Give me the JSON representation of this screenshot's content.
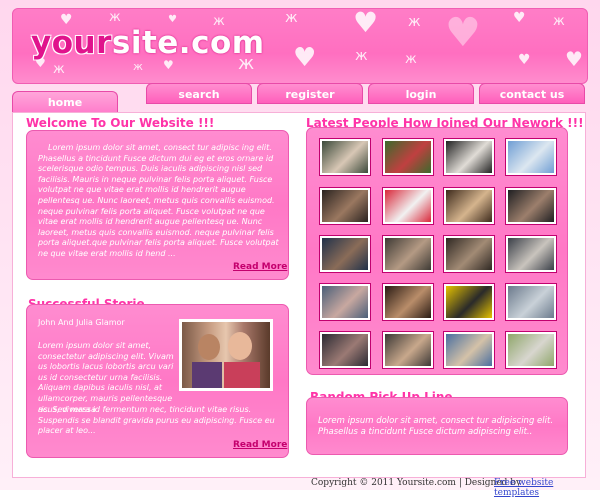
{
  "logo": {
    "part_a": "your",
    "part_b": "site.com"
  },
  "nav": {
    "home": "home",
    "search": "search",
    "register": "register",
    "login": "login",
    "contact": "contact us"
  },
  "welcome": {
    "title": "Welcome To Our Website !!!",
    "body": "Lorem ipsum dolor sit amet, consect tur adipisc ing elit. Phasellus a tincidunt Fusce dictum dui eg et eros ornare id scelerisque odio tempus. Duis iaculis adipiscing nisl sed facilisis. Mauris in neque pulvinar felis porta aliquet. Fusce volutpat ne que vitae erat mollis id hendrerit augue pellentesq ue. Nunc laoreet, metus quis convallis euismod. neque pulvinar felis porta aliquet. Fusce volutpat ne que vitae erat mollis id hendrerit augue pellentesq ue. Nunc laoreet, metus quis convallis euismod. neque pulvinar felis porta aliquet.que pulvinar felis porta aliquet. Fusce volutpat ne que vitae erat mollis id hend ...",
    "read_more": "Read More"
  },
  "story": {
    "title": "Successful Storie",
    "couple": "John And Julia Glamor",
    "body_narrow": "Lorem ipsum dolor sit amet, consectetur adipiscing elit. Vivam us lobortis lacus lobortis arcu vari us id consectetur urna facilisis. Aliquam dapibus iaculis nisl, at ullamcorper, mauris pellentesque ac. Sed massa",
    "body_wide": "risus, viverra id fermentum nec, tincidunt vitae risus. Suspendis se blandit gravida purus eu adipiscing. Fusce eu placer at leo...",
    "read_more": "Read More"
  },
  "members": {
    "title": "Latest People How Joined Our Nework !!!",
    "thumbs": [
      {
        "c1": "#3b4a3a",
        "c2": "#d8c7b5"
      },
      {
        "c1": "#3c6a2c",
        "c2": "#c04040"
      },
      {
        "c1": "#222222",
        "c2": "#e0dcd6"
      },
      {
        "c1": "#6f9ed4",
        "c2": "#dce7f0"
      },
      {
        "c1": "#2a2320",
        "c2": "#9a7860"
      },
      {
        "c1": "#d9283a",
        "c2": "#f1f1f1"
      },
      {
        "c1": "#3d2a1c",
        "c2": "#d5b48d"
      },
      {
        "c1": "#1f1f22",
        "c2": "#9c7f6c"
      },
      {
        "c1": "#20314a",
        "c2": "#8a6c58"
      },
      {
        "c1": "#3e3a35",
        "c2": "#b49a84"
      },
      {
        "c1": "#2f2823",
        "c2": "#a28b75"
      },
      {
        "c1": "#3a3f48",
        "c2": "#c9c4bd"
      },
      {
        "c1": "#4a5f78",
        "c2": "#c8a8a0"
      },
      {
        "c1": "#2a1b14",
        "c2": "#b98d6a"
      },
      {
        "c1": "#e5c200",
        "c2": "#2a2a2a"
      },
      {
        "c1": "#6b7a8c",
        "c2": "#c9d1d8"
      },
      {
        "c1": "#2b2a33",
        "c2": "#9b7a74"
      },
      {
        "c1": "#3c3836",
        "c2": "#c8a88c"
      },
      {
        "c1": "#4a6fa0",
        "c2": "#d4c2a8"
      },
      {
        "c1": "#8fa66a",
        "c2": "#d8d6cf"
      }
    ]
  },
  "pickup": {
    "title": "Random Pick Up Line",
    "body": "Lorem ipsum dolor sit amet, consect tur adipiscing elit. Phasellus a tincidunt Fusce dictum adipiscing elit.."
  },
  "footer": {
    "copyright": "Copyright © 2011 Yoursite.com | Designed by",
    "link": "Free website templates"
  }
}
